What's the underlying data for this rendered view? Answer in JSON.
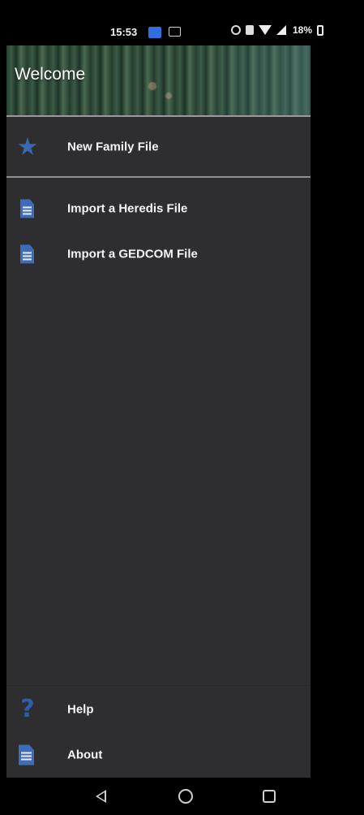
{
  "status_bar": {
    "time": "15:53",
    "battery": "18%"
  },
  "drawer": {
    "header_title": "Welcome",
    "items": [
      {
        "label": "New Family File",
        "icon": "star-icon"
      },
      {
        "label": "Import a Heredis File",
        "icon": "heredis-file-icon"
      },
      {
        "label": "Import a GEDCOM File",
        "icon": "gedcom-file-icon"
      }
    ],
    "bottom_items": [
      {
        "label": "Help",
        "icon": "help-icon"
      },
      {
        "label": "About",
        "icon": "document-icon"
      }
    ]
  },
  "colors": {
    "drawer_bg": "#2e2e30",
    "accent_blue": "#3a68b0"
  }
}
